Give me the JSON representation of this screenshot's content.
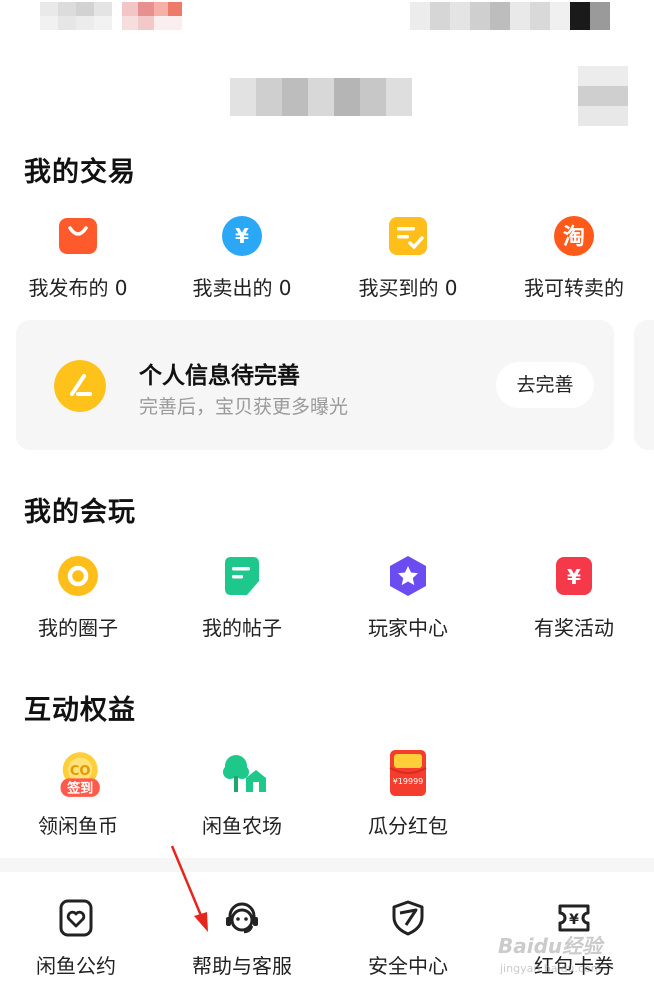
{
  "trade": {
    "title": "我的交易",
    "items": [
      {
        "label": "我发布的 0",
        "icon": "shopping-bag-icon",
        "color": "#ff5a2c"
      },
      {
        "label": "我卖出的 0",
        "icon": "yen-coin-icon",
        "color": "#2aa8f5"
      },
      {
        "label": "我买到的 0",
        "icon": "checklist-icon",
        "color": "#ffbe1a"
      },
      {
        "label": "我可转卖的",
        "icon": "taobao-icon",
        "color": "#ff5a1a"
      }
    ]
  },
  "profile_card": {
    "title": "个人信息待完善",
    "subtitle": "完善后，宝贝获更多曝光",
    "button": "去完善"
  },
  "play": {
    "title": "我的会玩",
    "items": [
      {
        "label": "我的圈子",
        "icon": "circle-ring-icon",
        "color": "#ffbe1a"
      },
      {
        "label": "我的帖子",
        "icon": "post-note-icon",
        "color": "#1ec88a"
      },
      {
        "label": "玩家中心",
        "icon": "star-hexagon-icon",
        "color": "#6a4cf0"
      },
      {
        "label": "有奖活动",
        "icon": "prize-yen-icon",
        "color": "#f5384a"
      }
    ]
  },
  "benefits": {
    "title": "互动权益",
    "items": [
      {
        "label": "领闲鱼币",
        "icon": "sign-in-coin-icon",
        "badge": "签到"
      },
      {
        "label": "闲鱼农场",
        "icon": "farm-tree-icon"
      },
      {
        "label": "瓜分红包",
        "icon": "red-packet-icon",
        "amount": "¥19999"
      }
    ]
  },
  "bottom": {
    "items": [
      {
        "label": "闲鱼公约",
        "icon": "convention-heart-icon"
      },
      {
        "label": "帮助与客服",
        "icon": "customer-service-icon"
      },
      {
        "label": "安全中心",
        "icon": "shield-icon"
      },
      {
        "label": "红包卡券",
        "icon": "coupon-ticket-icon"
      }
    ]
  },
  "watermark": {
    "brand": "Baidu经验",
    "url": "jingyan.baidu.com"
  },
  "colors": {
    "accent": "#ffc21a",
    "arrow": "#e8251c"
  }
}
